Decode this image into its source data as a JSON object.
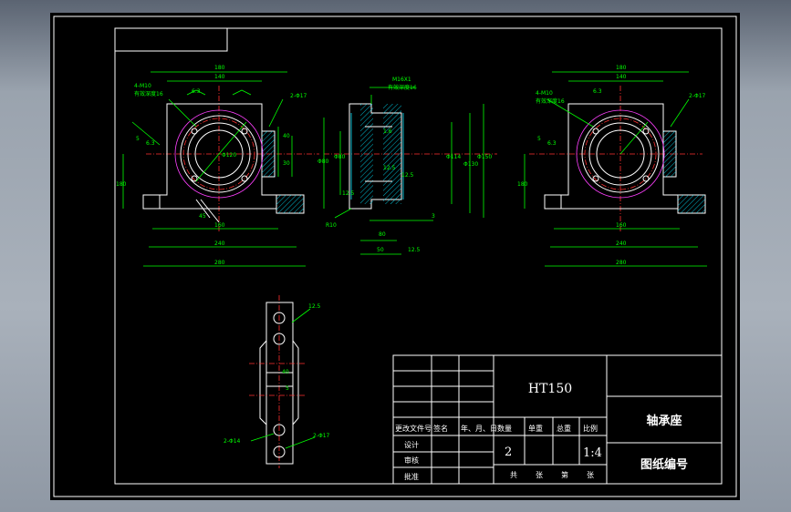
{
  "title_block": {
    "material": "HT150",
    "part_name": "轴承座",
    "drawing_number_label": "图纸编号",
    "quantity": "2",
    "scale": "1:4",
    "header_labels": {
      "revision_file_no": "更改文件号",
      "signature": "签名",
      "date": "年、月、日",
      "quantity": "数量",
      "unit_weight": "单重",
      "total_weight": "总重",
      "scale": "比例"
    },
    "row_labels": {
      "design": "设计",
      "review": "审核",
      "approve": "批准"
    },
    "sheet_info": {
      "total": "共",
      "sheet": "张",
      "no": "第",
      "page": "张"
    }
  },
  "dimensions": {
    "front": {
      "top_outer": "180",
      "top_inner": "140",
      "holes": "4-M10",
      "holes_note": "有效深度16",
      "left_small": "5",
      "left_ra": "6.3",
      "height": "180",
      "base_inner": "160",
      "base_middle": "240",
      "base_outer": "280",
      "right_holes": "2-Φ17",
      "right_a": "40",
      "right_b": "30",
      "top_ra": "6.3",
      "dia_center": "Φ120",
      "angle": "45"
    },
    "section": {
      "thread": "M16X1",
      "thread_note": "有效深度16",
      "left_dia": "Φ80",
      "left_inner": "Φ80",
      "mid_dia": "Φ114",
      "right_dia": "Φ130",
      "right_dia2": "Φ150",
      "ra_a": "1.6",
      "ra_b": "12.5",
      "ra_c": "12.5",
      "ra_d": "12.5",
      "bottom_a": "80",
      "bottom_b": "50",
      "bottom_c": "3",
      "bottom_d": "12.5",
      "chamfer": "R10"
    },
    "iso": {
      "top_outer": "180",
      "top_inner": "140",
      "holes": "4-M10",
      "holes_note": "有效深度16",
      "left_small": "5",
      "left_ra": "6.3",
      "height": "180",
      "base_inner": "160",
      "base_middle": "240",
      "base_outer": "280",
      "right_holes": "2-Φ17",
      "top_ra": "6.3"
    },
    "side": {
      "top_ra": "12.5",
      "mid_a": "40",
      "mid_b": "5",
      "hole_left": "2-Φ14",
      "hole_right": "2-Φ17"
    }
  }
}
